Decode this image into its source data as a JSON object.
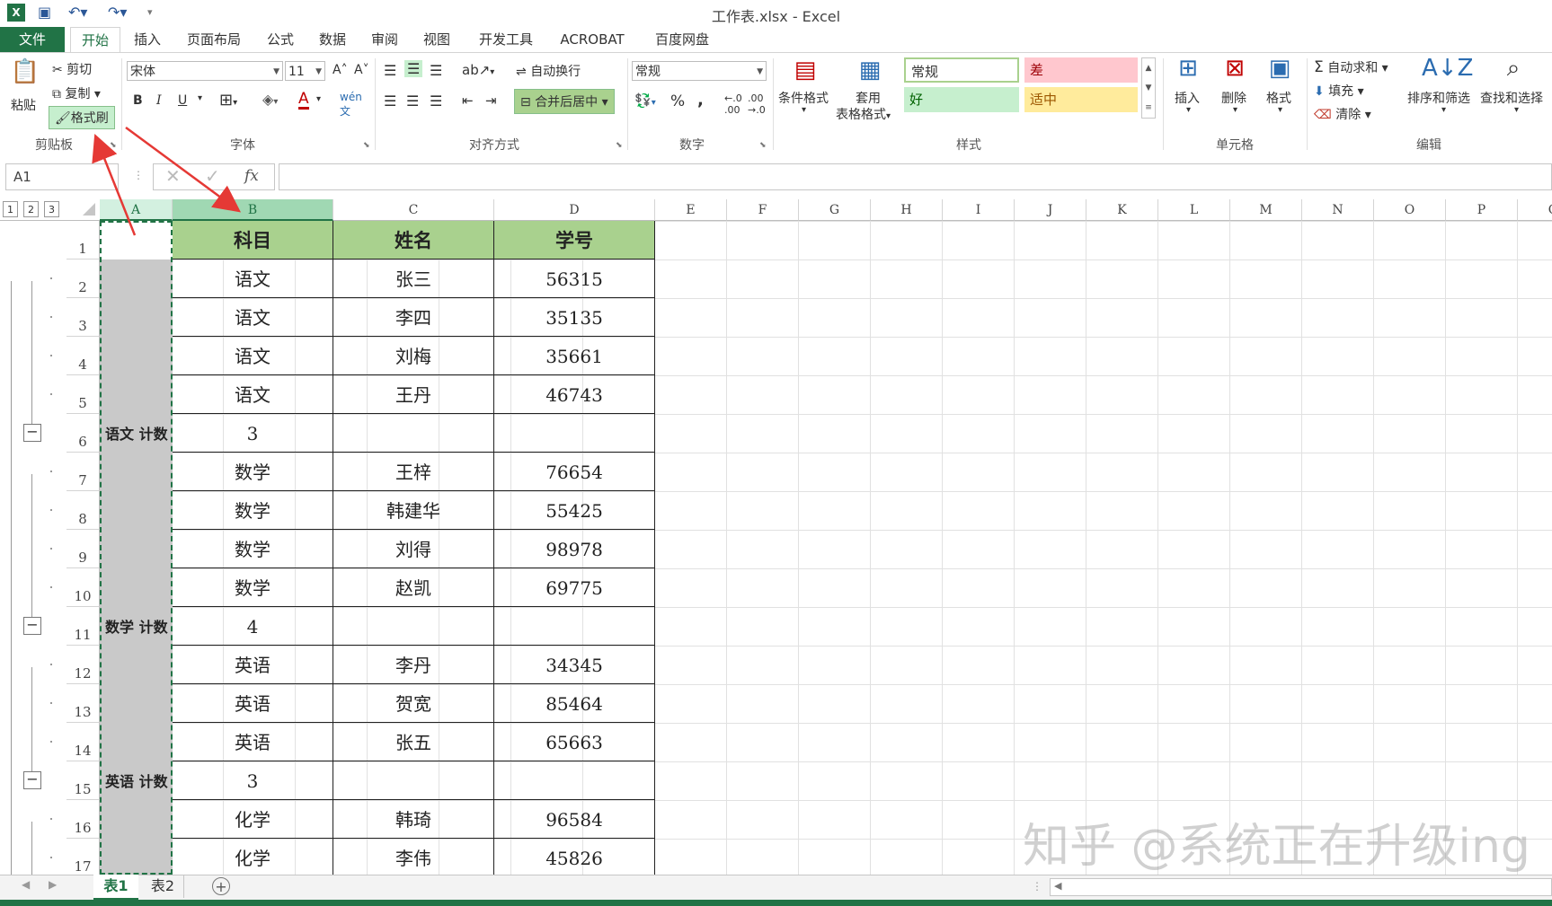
{
  "window": {
    "title": "工作表.xlsx - Excel"
  },
  "tabs": [
    "文件",
    "开始",
    "插入",
    "页面布局",
    "公式",
    "数据",
    "审阅",
    "视图",
    "开发工具",
    "ACROBAT",
    "百度网盘"
  ],
  "clipboard": {
    "paste": "粘贴",
    "cut": "剪切",
    "copy": "复制",
    "format_painter": "格式刷",
    "label": "剪贴板"
  },
  "font": {
    "name": "宋体",
    "size": "11",
    "label": "字体",
    "bold": "B",
    "italic": "I",
    "underline": "U"
  },
  "alignment": {
    "wrap": "自动换行",
    "merge": "合并后居中",
    "label": "对齐方式"
  },
  "number": {
    "format": "常规",
    "percent": "%",
    "comma": ",",
    "label": "数字"
  },
  "styles": {
    "conditional": "条件格式",
    "table_format_1": "套用",
    "table_format_2": "表格格式",
    "normal": "常规",
    "bad": "差",
    "good": "好",
    "neutral": "适中",
    "label": "样式",
    "colors": {
      "normal_bg": "#ffffff",
      "bad_bg": "#ffc7ce",
      "bad_fg": "#9c0006",
      "good_bg": "#c6efce",
      "good_fg": "#006100",
      "neutral_bg": "#ffeb9c",
      "neutral_fg": "#9c5700"
    }
  },
  "cells_group": {
    "insert": "插入",
    "delete": "删除",
    "format": "格式",
    "label": "单元格"
  },
  "editing": {
    "autosum": "自动求和",
    "fill": "填充",
    "clear": "清除",
    "sort": "排序和筛选",
    "find": "查找和选择",
    "label": "编辑"
  },
  "formula_bar": {
    "name_box": "A1",
    "fx": "fx",
    "value": ""
  },
  "outline_levels": [
    "1",
    "2",
    "3"
  ],
  "columns": [
    "A",
    "B",
    "C",
    "D",
    "E",
    "F",
    "G",
    "H",
    "I",
    "J",
    "K",
    "L",
    "M",
    "N",
    "O",
    "P",
    "Q"
  ],
  "table": {
    "header": [
      "科目",
      "姓名",
      "学号"
    ],
    "rows": [
      {
        "row": "1",
        "a": "",
        "b": "科目",
        "c": "姓名",
        "d": "学号",
        "type": "header"
      },
      {
        "row": "2",
        "a": "",
        "b": "语文",
        "c": "张三",
        "d": "56315"
      },
      {
        "row": "3",
        "a": "",
        "b": "语文",
        "c": "李四",
        "d": "35135"
      },
      {
        "row": "4",
        "a": "",
        "b": "语文",
        "c": "刘梅",
        "d": "35661"
      },
      {
        "row": "5",
        "a": "",
        "b": "语文",
        "c": "王丹",
        "d": "46743"
      },
      {
        "row": "6",
        "a": "语文 计数",
        "b": "3",
        "c": "",
        "d": "",
        "type": "subtotal"
      },
      {
        "row": "7",
        "a": "",
        "b": "数学",
        "c": "王梓",
        "d": "76654"
      },
      {
        "row": "8",
        "a": "",
        "b": "数学",
        "c": "韩建华",
        "d": "55425"
      },
      {
        "row": "9",
        "a": "",
        "b": "数学",
        "c": "刘得",
        "d": "98978"
      },
      {
        "row": "10",
        "a": "",
        "b": "数学",
        "c": "赵凯",
        "d": "69775"
      },
      {
        "row": "11",
        "a": "数学 计数",
        "b": "4",
        "c": "",
        "d": "",
        "type": "subtotal"
      },
      {
        "row": "12",
        "a": "",
        "b": "英语",
        "c": "李丹",
        "d": "34345"
      },
      {
        "row": "13",
        "a": "",
        "b": "英语",
        "c": "贺宽",
        "d": "85464"
      },
      {
        "row": "14",
        "a": "",
        "b": "英语",
        "c": "张五",
        "d": "65663"
      },
      {
        "row": "15",
        "a": "英语 计数",
        "b": "3",
        "c": "",
        "d": "",
        "type": "subtotal"
      },
      {
        "row": "16",
        "a": "",
        "b": "化学",
        "c": "韩琦",
        "d": "96584"
      },
      {
        "row": "17",
        "a": "",
        "b": "化学",
        "c": "李伟",
        "d": "45826"
      }
    ]
  },
  "sheets": [
    "表1",
    "表2"
  ],
  "watermark": "知乎 @系统正在升级ing"
}
